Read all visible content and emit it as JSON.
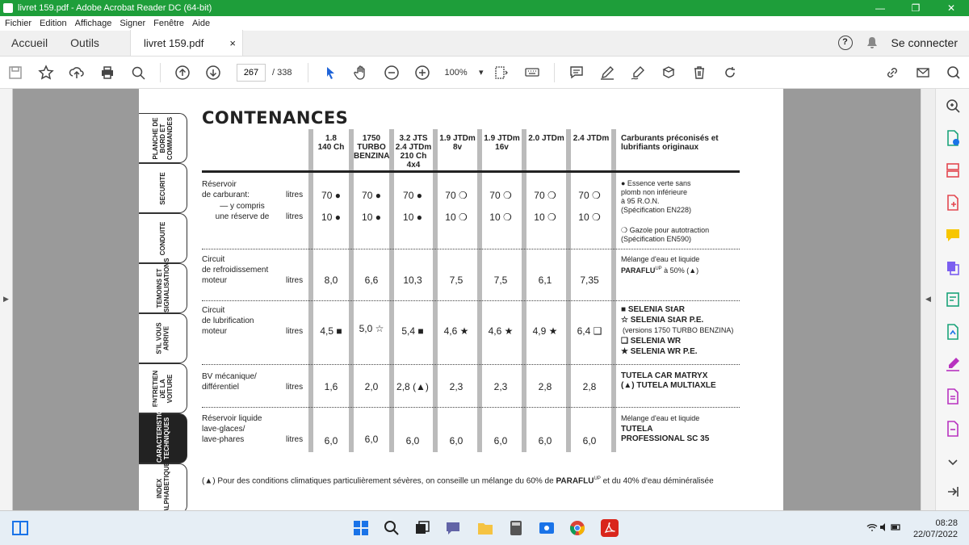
{
  "window": {
    "title": "livret 159.pdf - Adobe Acrobat Reader DC (64-bit)",
    "controls": [
      "—",
      "❐",
      "✕"
    ]
  },
  "menu": [
    "Fichier",
    "Edition",
    "Affichage",
    "Signer",
    "Fenêtre",
    "Aide"
  ],
  "tabs": {
    "home": "Accueil",
    "tools": "Outils",
    "doc": "livret 159.pdf",
    "close": "×",
    "signin": "Se connecter",
    "help": "?"
  },
  "toolbar": {
    "page_current": "267",
    "page_total": "/ 338",
    "zoom": "100%"
  },
  "side_tabs": [
    {
      "label": "PLANCHE DE\nBORD ET\nCOMMANDES",
      "active": false
    },
    {
      "label": "SECURITE",
      "active": false
    },
    {
      "label": "CONDUITE",
      "active": false
    },
    {
      "label": "TEMOINS ET\nSIGNALISATIONS",
      "active": false
    },
    {
      "label": "S'IL VOUS\nARRIVE",
      "active": false
    },
    {
      "label": "ENTRETIEN\nDE LA VOITURE",
      "active": false
    },
    {
      "label": "CARACTERISTIQUES\nTECHNIQUES",
      "active": true
    },
    {
      "label": "INDEX\nALPHABETIQUE",
      "active": false
    }
  ],
  "doc": {
    "heading": "CONTENANCES",
    "columns": [
      "1.8\n140 Ch",
      "1750\nTURBO\nBENZINA",
      "3.2 JTS\n2.4 JTDm\n210 Ch\n4x4",
      "1.9 JTDm\n8v",
      "1.9 JTDm\n16v",
      "2.0 JTDm",
      "2.4 JTDm"
    ],
    "fuel_header": "Carburants préconisés et\nlubrifiants originaux",
    "rows": {
      "tank": {
        "label": "Réservoir\nde carburant:",
        "label2": "— y compris\nune réserve de",
        "unit": "litres",
        "values": [
          "70 ●",
          "70 ●",
          "70 ●",
          "70 ❍",
          "70 ❍",
          "70 ❍",
          "70 ❍"
        ],
        "values2": [
          "10 ●",
          "10 ●",
          "10 ●",
          "10 ❍",
          "10 ❍",
          "10 ❍",
          "10 ❍"
        ],
        "note1": "● Essence verte sans\nplomb non inférieure\nà 95 R.O.N.\n(Spécification EN228)",
        "note2": "❍ Gazole pour autotraction\n(Spécification EN590)"
      },
      "cooling": {
        "label": "Circuit\nde refroidissement\nmoteur",
        "unit": "litres",
        "values": [
          "8,0",
          "6,6",
          "10,3",
          "7,5",
          "7,5",
          "6,1",
          "7,35"
        ],
        "note": "Mélange d'eau et liquide",
        "note_b": "PARAFLU",
        "note_sup": "UP",
        "note_tail": " à 50% (▲)"
      },
      "lubrication": {
        "label": "Circuit\nde lubrification\nmoteur",
        "unit": "litres",
        "values": [
          "4,5 ■",
          "5,0 ☆",
          "5,4 ■",
          "4,6 ★",
          "4,6 ★",
          "4,9 ★",
          "6,4 ❑"
        ],
        "note1": "■ SELENIA StAR",
        "note2": "☆ SELENIA StAR P.E.",
        "note3": "(versions 1750 TURBO BENZINA)",
        "note4": "❑ SELENIA WR",
        "note5": "★ SELENIA WR P.E."
      },
      "gearbox": {
        "label": "BV mécanique/\ndifférentiel",
        "unit": "litres",
        "values": [
          "1,6",
          "2,0",
          "2,8 (▲)",
          "2,3",
          "2,3",
          "2,8",
          "2,8"
        ],
        "note": "TUTELA CAR MATRYX\n(▲) TUTELA MULTIAXLE"
      },
      "washer": {
        "label": "Réservoir liquide\nlave-glaces/\nlave-phares",
        "unit": "litres",
        "values": [
          "6,0",
          "6,0",
          "6,0",
          "6,0",
          "6,0",
          "6,0",
          "6,0"
        ],
        "note": "Mélange d'eau et liquide",
        "note_b": "TUTELA\nPROFESSIONAL SC 35"
      }
    },
    "footnote_pre": "(▲) Pour des conditions climatiques particulièrement sévères, on conseille un mélange du 60% de ",
    "footnote_b": "PARAFLU",
    "footnote_sup": "UP",
    "footnote_post": " et du 40% d'eau déminéralisée"
  },
  "taskbar": {
    "time": "08:28",
    "date": "22/07/2022"
  }
}
